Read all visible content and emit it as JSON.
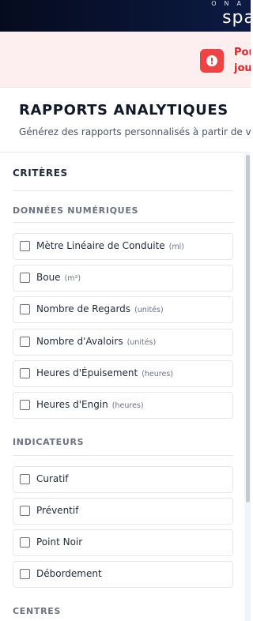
{
  "brand": {
    "small": "ONA",
    "large": "spa"
  },
  "alert": {
    "line1": "Pou",
    "line2": "jou"
  },
  "header": {
    "title": "RAPPORTS ANALYTIQUES",
    "subtitle": "Générez des rapports personnalisés à partir de vos"
  },
  "criteria": {
    "title": "CRITÈRES",
    "numeric_section": "DONNÉES NUMÉRIQUES",
    "numeric_items": [
      {
        "label": "Mètre Linéaire de Conduite",
        "unit": "(ml)"
      },
      {
        "label": "Boue",
        "unit": "(m³)"
      },
      {
        "label": "Nombre de Regards",
        "unit": "(unités)"
      },
      {
        "label": "Nombre d'Avaloirs",
        "unit": "(unités)"
      },
      {
        "label": "Heures d'Épuisement",
        "unit": "(heures)"
      },
      {
        "label": "Heures d'Engin",
        "unit": "(heures)"
      }
    ],
    "indicators_section": "INDICATEURS",
    "indicator_items": [
      {
        "label": "Curatif"
      },
      {
        "label": "Préventif"
      },
      {
        "label": "Point Noir"
      },
      {
        "label": "Débordement"
      }
    ],
    "centres_section": "CENTRES"
  }
}
